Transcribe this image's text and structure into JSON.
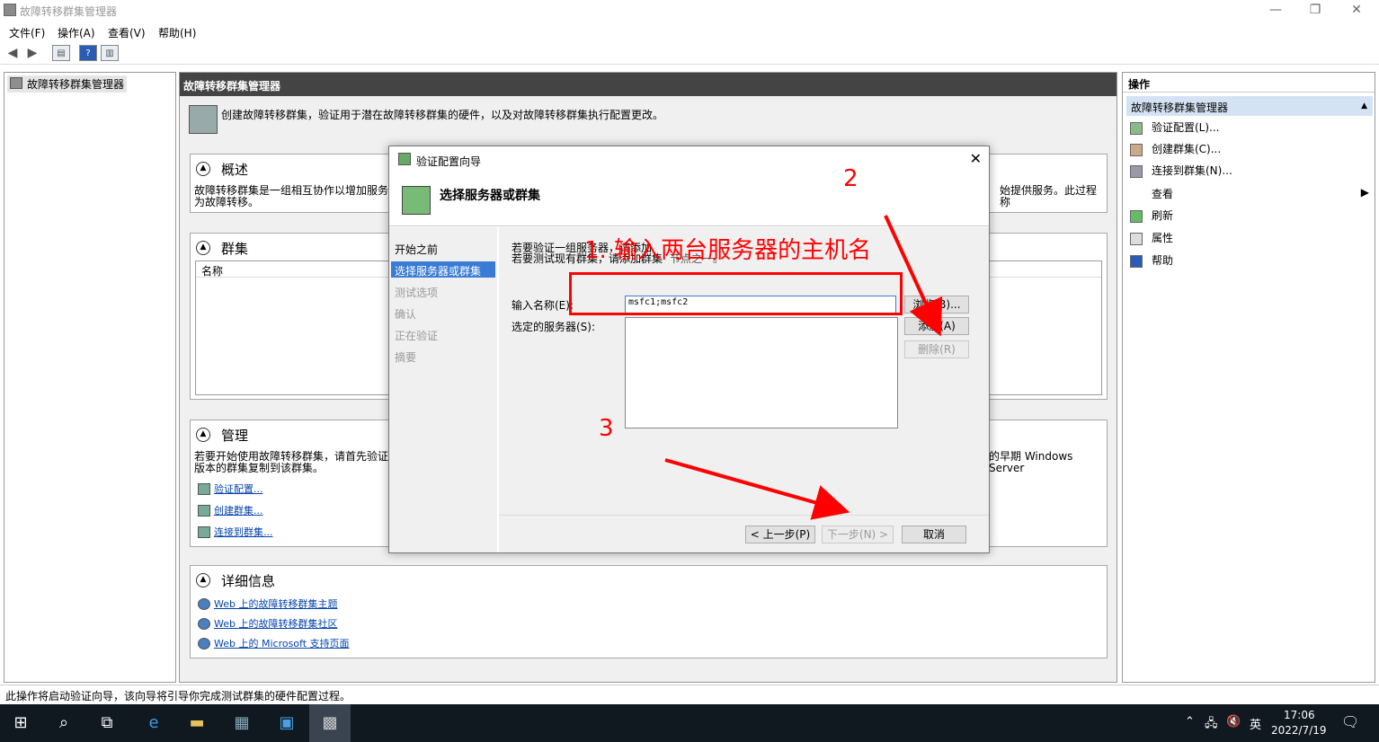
{
  "window": {
    "title": "故障转移群集管理器",
    "min": "—",
    "restore": "❐",
    "close": "✕"
  },
  "menu": [
    "文件(F)",
    "操作(A)",
    "查看(V)",
    "帮助(H)"
  ],
  "tree": {
    "root": "故障转移群集管理器"
  },
  "center": {
    "header": "故障转移群集管理器",
    "intro": "创建故障转移群集，验证用于潜在故障转移群集的硬件，以及对故障转移群集执行配置更改。",
    "overview": {
      "title": "概述",
      "line1_left": "故障转移群集是一组相互协作以增加服务",
      "line1_right": "始提供服务。此过程称",
      "line2": "为故障转移。"
    },
    "clusters": {
      "title": "群集",
      "col_name": "名称"
    },
    "manage": {
      "title": "管理",
      "line1_left": "若要开始使用故障转移群集，请首先验证",
      "line1_right": "的早期 Windows Server",
      "line2": "版本的群集复制到该群集。",
      "links": [
        "验证配置...",
        "创建群集...",
        "连接到群集..."
      ]
    },
    "details": {
      "title": "详细信息",
      "links": [
        "Web 上的故障转移群集主题",
        "Web 上的故障转移群集社区",
        "Web 上的 Microsoft 支持页面"
      ]
    }
  },
  "actions": {
    "header": "操作",
    "section": "故障转移群集管理器",
    "items": [
      "验证配置(L)...",
      "创建群集(C)...",
      "连接到群集(N)...",
      "查看",
      "刷新",
      "属性",
      "帮助"
    ]
  },
  "status": "此操作将启动验证向导，该向导将引导你完成测试群集的硬件配置过程。",
  "dialog": {
    "title": "验证配置向导",
    "heading": "选择服务器或群集",
    "nav": [
      "开始之前",
      "选择服务器或群集",
      "测试选项",
      "确认",
      "正在验证",
      "摘要"
    ],
    "desc1": "若要验证一组服务器，请添加",
    "desc2": "若要测试现有群集，请添加群集",
    "desc2_tail": "节点之一。",
    "name_label": "输入名称(E):",
    "name_value": "msfc1;msfc2",
    "selected_label": "选定的服务器(S):",
    "browse": "浏览(B)...",
    "add": "添加(A)",
    "remove": "删除(R)",
    "back": "< 上一步(P)",
    "next": "下一步(N) >",
    "cancel": "取消"
  },
  "annotations": {
    "step1": "1. 输入两台服务器的主机名",
    "step2": "2",
    "step3": "3"
  },
  "taskbar": {
    "lang": "英",
    "time": "17:06",
    "date": "2022/7/19"
  }
}
